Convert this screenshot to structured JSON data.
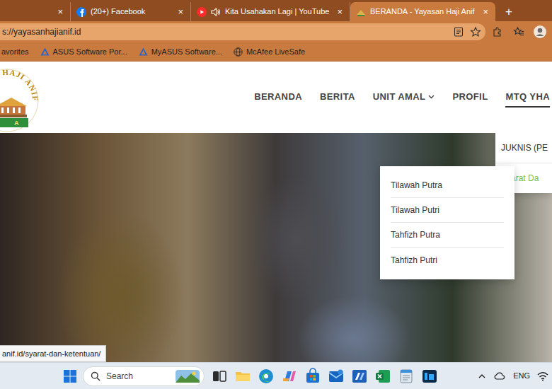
{
  "browser": {
    "tabs": [
      {
        "kind": "partial",
        "close": "×",
        "selected": false,
        "audio": false
      },
      {
        "kind": "full",
        "label": "(20+) Facebook",
        "close": "×",
        "selected": false,
        "audio": false
      },
      {
        "kind": "full",
        "label": "Kita Usahakan Lagi | YouTube",
        "close": "×",
        "selected": false,
        "audio": true
      },
      {
        "kind": "full",
        "label": "BERANDA - Yayasan Haji Anif",
        "close": "×",
        "selected": true,
        "audio": false
      }
    ],
    "new_tab": "+",
    "address": {
      "url": "s://yayasanhajianif.id"
    },
    "favorites": [
      {
        "label": "avorites"
      },
      {
        "label": "ASUS Software Por..."
      },
      {
        "label": "MyASUS Software..."
      },
      {
        "label": "McAfee LiveSafe"
      }
    ]
  },
  "site": {
    "logo": {
      "arc": "HAJI ANIF",
      "band": "A"
    },
    "nav": [
      {
        "label": "BERANDA",
        "selected": false,
        "has_menu": false
      },
      {
        "label": "BERITA",
        "selected": false,
        "has_menu": false
      },
      {
        "label": "UNIT AMAL",
        "selected": false,
        "has_menu": true
      },
      {
        "label": "PROFIL",
        "selected": false,
        "has_menu": false
      },
      {
        "label": "MTQ YHA",
        "selected": true,
        "has_menu": false
      }
    ],
    "menu": [
      {
        "label": "JUKNIS (PE",
        "highlighted": false
      },
      {
        "label": "Syarat Da",
        "highlighted": true
      }
    ],
    "submenu": [
      {
        "label": "Tilawah Putra"
      },
      {
        "label": "Tilawah Putri"
      },
      {
        "label": "Tahfizh Putra"
      },
      {
        "label": "Tahfizh Putri"
      }
    ]
  },
  "status_url": "anif.id/syarat-dan-ketentuan/",
  "taskbar": {
    "search": {
      "placeholder": "Search"
    },
    "language": "ENG"
  }
}
